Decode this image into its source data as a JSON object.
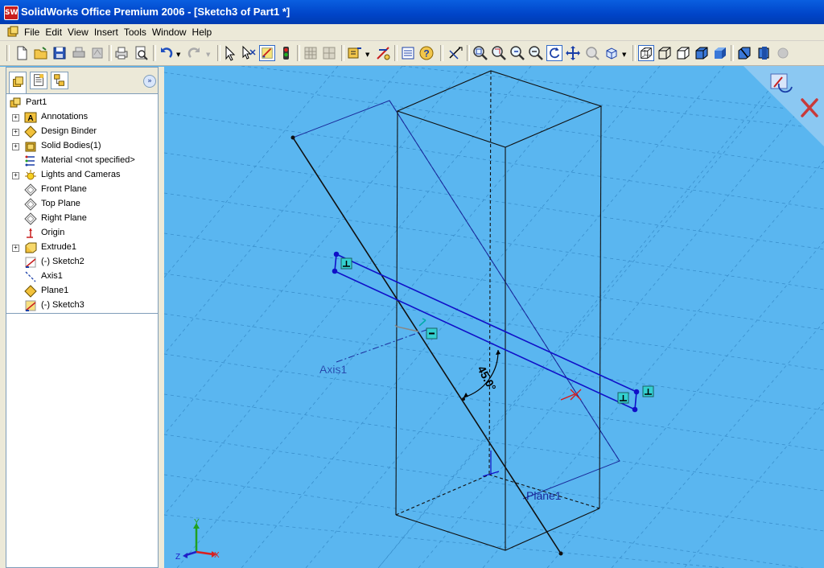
{
  "window": {
    "title": "SolidWorks Office Premium 2006 - [Sketch3 of Part1 *]",
    "app_icon": "SW"
  },
  "menu": [
    "File",
    "Edit",
    "View",
    "Insert",
    "Tools",
    "Window",
    "Help"
  ],
  "toolbar": [
    "new",
    "open",
    "save",
    "print-3d",
    "print",
    "print-preview",
    "undo",
    "redo",
    "select",
    "smart-dimension-select",
    "sketch",
    "rebuild",
    "grid-1",
    "grid-2",
    "annotation",
    "add-dim",
    "properties",
    "help",
    "smart-dimension",
    "zoom-fit",
    "zoom-area",
    "zoom-prev",
    "zoom-in-out",
    "rotate",
    "pan",
    "zoom-sel",
    "view-orient",
    "isometric",
    "wireframe",
    "hidden-lines",
    "shaded-edges",
    "shaded",
    "section",
    "pers",
    "shadow"
  ],
  "tree": {
    "root": "Part1",
    "items": [
      {
        "label": "Annotations",
        "icon": "annotations-icon",
        "expandable": true
      },
      {
        "label": "Design Binder",
        "icon": "design-binder-icon",
        "expandable": true
      },
      {
        "label": "Solid Bodies(1)",
        "icon": "solid-bodies-icon",
        "expandable": true
      },
      {
        "label": "Material <not specified>",
        "icon": "material-icon",
        "expandable": false
      },
      {
        "label": "Lights and Cameras",
        "icon": "lights-icon",
        "expandable": true
      },
      {
        "label": "Front Plane",
        "icon": "plane-icon",
        "expandable": false
      },
      {
        "label": "Top Plane",
        "icon": "plane-icon",
        "expandable": false
      },
      {
        "label": "Right Plane",
        "icon": "plane-icon",
        "expandable": false
      },
      {
        "label": "Origin",
        "icon": "origin-icon",
        "expandable": false
      },
      {
        "label": "Extrude1",
        "icon": "extrude-icon",
        "expandable": true
      },
      {
        "label": "(-) Sketch2",
        "icon": "sketch-icon",
        "expandable": false
      },
      {
        "label": "Axis1",
        "icon": "axis-icon",
        "expandable": false
      },
      {
        "label": "Plane1",
        "icon": "plane1-icon",
        "expandable": false
      },
      {
        "label": "(-) Sketch3",
        "icon": "sketch3-icon",
        "expandable": false
      }
    ]
  },
  "viewport": {
    "axis_label": "Axis1",
    "plane_label": "Plane1",
    "angle_dimension": "45.0°",
    "triad": {
      "x": "X",
      "y": "Y",
      "z": "Z"
    }
  },
  "colors": {
    "background": "#5ab6f0",
    "sketch": "#1010c8",
    "model": "#101010",
    "title_bar": "#0054e3"
  }
}
